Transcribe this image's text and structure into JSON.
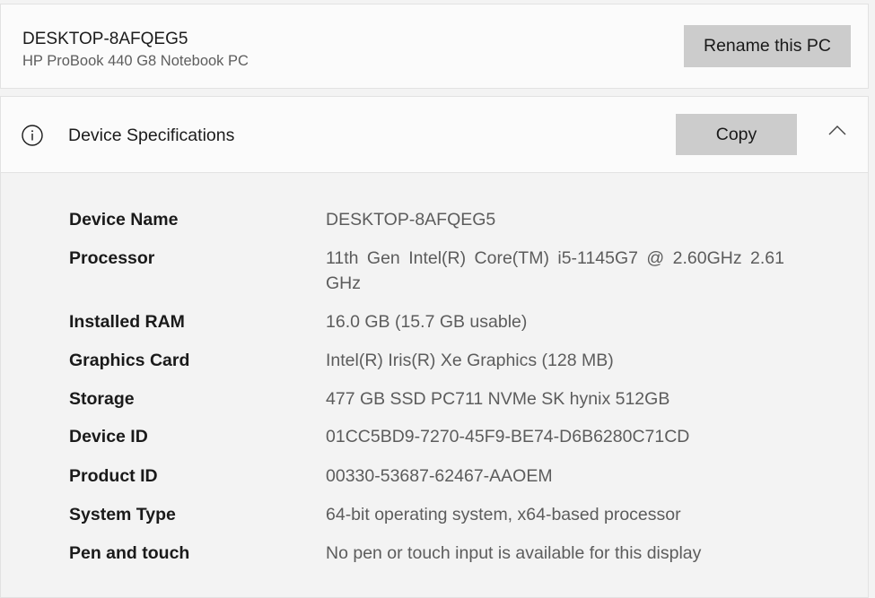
{
  "pc": {
    "name": "DESKTOP-8AFQEG5",
    "model": "HP ProBook 440 G8 Notebook PC",
    "rename_label": "Rename this PC"
  },
  "specs": {
    "title": "Device Specifications",
    "copy_label": "Copy",
    "info_icon": "info-icon",
    "collapse_icon": "chevron-up-icon",
    "rows": [
      {
        "label": "Device Name",
        "value": "DESKTOP-8AFQEG5"
      },
      {
        "label": "Processor",
        "value": "11th Gen Intel(R) Core(TM) i5-1145G7 @ 2.60GHz   2.61 GHz"
      },
      {
        "label": "Installed RAM",
        "value": "16.0 GB (15.7 GB usable)"
      },
      {
        "label": "Graphics Card",
        "value": "Intel(R) Iris(R) Xe Graphics (128 MB)"
      },
      {
        "label": "Storage",
        "value": "477 GB SSD PC711 NVMe SK hynix 512GB"
      },
      {
        "label": "Device ID",
        "value": "01CC5BD9-7270-45F9-BE74-D6B6280C71CD"
      },
      {
        "label": "Product ID",
        "value": "00330-53687-62467-AAOEM"
      },
      {
        "label": "System Type",
        "value": "64-bit operating system, x64-based processor"
      },
      {
        "label": "Pen and touch",
        "value": "No pen or touch input is available for this display"
      }
    ]
  }
}
